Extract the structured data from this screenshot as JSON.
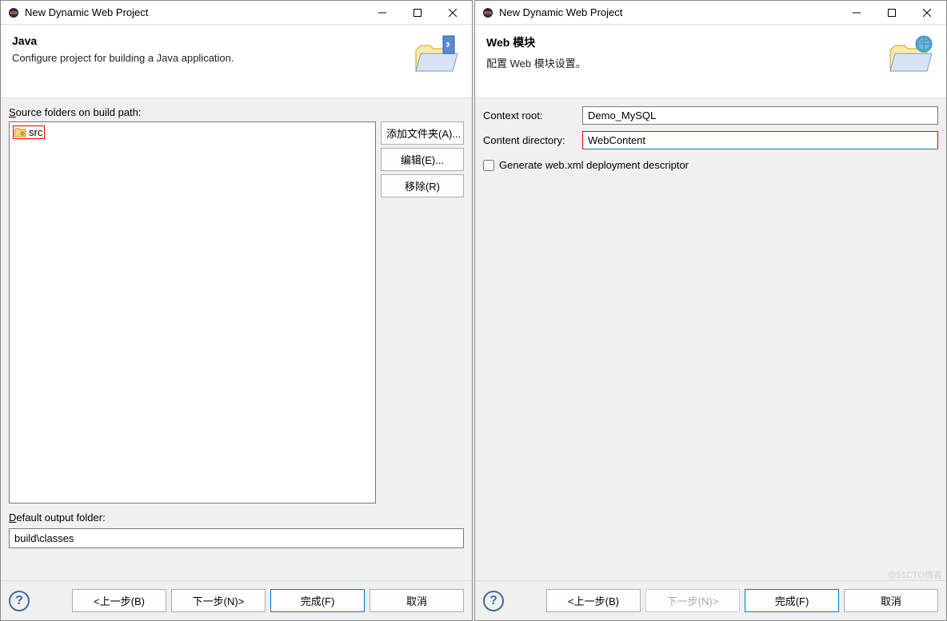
{
  "left": {
    "windowTitle": "New Dynamic Web Project",
    "heading": "Java",
    "description": "Configure project for building a Java application.",
    "sourceLabelPre": "S",
    "sourceLabelPost": "ource folders on build path:",
    "srcItem": "src",
    "buttons": {
      "add": "添加文件夹(A)...",
      "edit": "编辑(E)...",
      "remove": "移除(R)"
    },
    "outputLabelPre": "D",
    "outputLabelPost": "efault output folder:",
    "outputValue": "build\\classes"
  },
  "right": {
    "windowTitle": "New Dynamic Web Project",
    "heading": "Web 模块",
    "description": "配置 Web 模块设置。",
    "contextLabel": "Context root:",
    "contextValue": "Demo_MySQL",
    "contentLabel": "Content directory:",
    "contentValue": "WebContent",
    "checkboxLabel": "Generate web.xml deployment descriptor"
  },
  "footer": {
    "back": "<上一步(B)",
    "next": "下一步(N)>",
    "finish": "完成(F)",
    "cancel": "取消"
  },
  "watermark": "@51CTO博客"
}
